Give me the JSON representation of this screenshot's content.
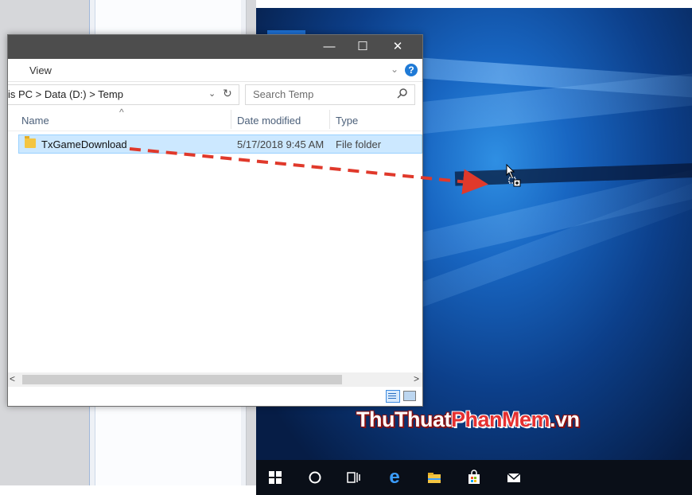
{
  "explorer": {
    "ribbon": {
      "view_tab": "View",
      "expand_glyph": "⌄",
      "help_glyph": "?"
    },
    "window_controls": {
      "minimize": "—",
      "maximize": "☐",
      "close": "✕"
    },
    "address": {
      "path_text": "is PC  >  Data (D:)  >  Temp",
      "dropdown_glyph": "⌄",
      "refresh_glyph": "↻"
    },
    "search": {
      "placeholder": "Search Temp",
      "icon": "search-icon"
    },
    "columns": {
      "name": "Name",
      "date_modified": "Date modified",
      "type": "Type",
      "sort_glyph": "^"
    },
    "rows": [
      {
        "name": "TxGameDownload",
        "date_modified": "5/17/2018 9:45 AM",
        "type": "File folder"
      }
    ],
    "scrollbar": {
      "left_glyph": "<",
      "right_glyph": ">"
    }
  },
  "watermark": {
    "part1": "ThuThuat",
    "part2": "PhanMem",
    "part3": ".vn"
  },
  "taskbar": {
    "icons": [
      "windows-start-icon",
      "cortana-search-icon",
      "task-view-icon",
      "edge-browser-icon",
      "file-explorer-icon",
      "store-icon",
      "mail-icon"
    ]
  },
  "colors": {
    "arrow": "#e0392b",
    "selection": "#cce8ff",
    "desktop": "#0c3f8a"
  }
}
